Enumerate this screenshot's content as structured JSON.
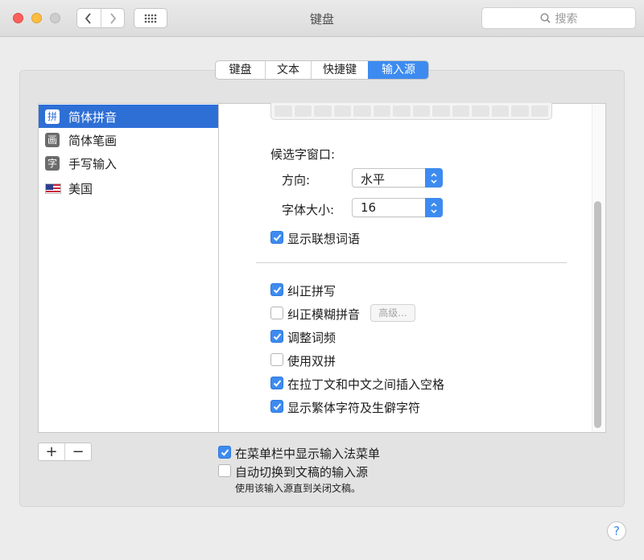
{
  "window": {
    "title": "键盘"
  },
  "search": {
    "placeholder": "搜索"
  },
  "tabs": [
    {
      "label": "键盘"
    },
    {
      "label": "文本"
    },
    {
      "label": "快捷键"
    },
    {
      "label": "输入源",
      "active": true
    }
  ],
  "sources": [
    {
      "icon_text": "拼",
      "label": "简体拼音",
      "selected": true
    },
    {
      "icon_text": "画",
      "label": "简体笔画"
    },
    {
      "icon_text": "字",
      "label": "手写输入"
    },
    {
      "icon": "us-flag-icon",
      "label": "美国"
    }
  ],
  "settings": {
    "candidate_window_label": "候选字窗口:",
    "direction_label": "方向:",
    "direction_value": "水平",
    "font_size_label": "字体大小:",
    "font_size_value": "16",
    "checkboxes_top": [
      {
        "label": "显示联想词语",
        "checked": true
      }
    ],
    "checkboxes": [
      {
        "label": "纠正拼写",
        "checked": true
      },
      {
        "label": "纠正模糊拼音",
        "checked": false
      },
      {
        "label": "调整词频",
        "checked": true
      },
      {
        "label": "使用双拼",
        "checked": false
      },
      {
        "label": "在拉丁文和中文之间插入空格",
        "checked": true
      },
      {
        "label": "显示繁体字符及生僻字符",
        "checked": true
      }
    ],
    "advanced_button": "高级..."
  },
  "footer": {
    "add_label": "+",
    "remove_label": "−",
    "show_menu_label": "在菜单栏中显示输入法菜单",
    "show_menu_checked": true,
    "auto_switch_label": "自动切换到文稿的输入源",
    "auto_switch_checked": false,
    "auto_switch_note": "使用该输入源直到关闭文稿。",
    "help_label": "?"
  },
  "colors": {
    "accent": "#3d8bf0",
    "selection": "#2e6fd6"
  }
}
